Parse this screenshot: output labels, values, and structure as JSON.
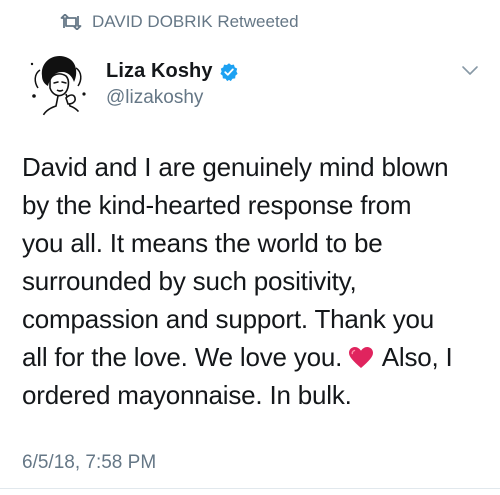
{
  "retweet": {
    "icon": "retweet-icon",
    "text": "DAVID DOBRIK Retweeted"
  },
  "author": {
    "display_name": "Liza Koshy",
    "handle": "@lizakoshy",
    "verified": true,
    "verified_icon": "verified-badge-icon",
    "avatar_icon": "avatar-illustration"
  },
  "menu": {
    "icon": "chevron-down-icon"
  },
  "tweet": {
    "lines": [
      "David and I are genuinely mind blown",
      "by the kind-hearted response from",
      "you all. It means the world to be",
      "surrounded by such positivity,",
      "compassion and support. Thank you",
      "all for the love. We love you.",
      "ordered mayonnaise. In bulk."
    ],
    "after_heart": "Also, I",
    "emoji": "heart-emoji"
  },
  "timestamp": "6/5/18, 7:58 PM",
  "colors": {
    "text": "#14171a",
    "secondary": "#657786",
    "verified": "#1da1f2",
    "heart": "#e0245e"
  }
}
